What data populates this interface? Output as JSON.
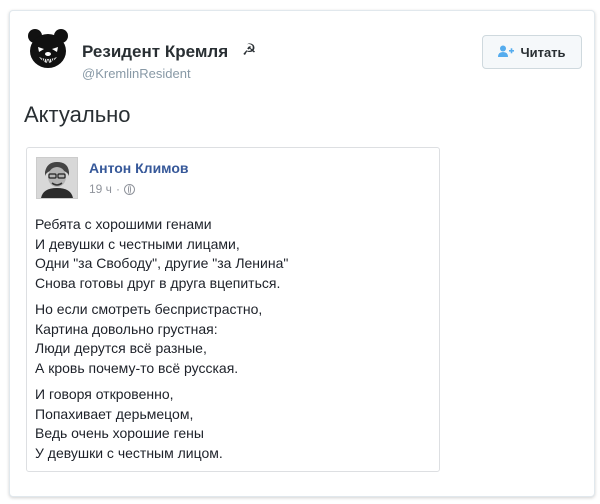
{
  "tweet": {
    "display_name": "Резидент Кремля",
    "name_emoji": "☭",
    "handle": "@KremlinResident",
    "follow_label": "Читать",
    "follow_icon": "add-user-icon",
    "text": "Актуально",
    "avatar_icon": "bear-icon"
  },
  "embed": {
    "author": "Антон Климов",
    "time": "19 ч",
    "separator": "·",
    "privacy_icon": "globe-icon",
    "photo": "portrait-photo",
    "stanzas": [
      [
        "Ребята с хорошими генами",
        "И девушки с честными лицами,",
        "Одни \"за Свободу\", другие \"за Ленина\"",
        "Снова готовы друг в друга вцепиться."
      ],
      [
        "Но если смотреть беспристрастно,",
        "Картина довольно грустная:",
        "Люди дерутся всё разные,",
        "А кровь почему-то всё русская."
      ],
      [
        "И говоря откровенно,",
        "Попахивает дерьмецом,",
        "Ведь очень хорошие гены",
        "У девушки с честным лицом."
      ]
    ]
  },
  "colors": {
    "name_link": "#365899",
    "meta_gray": "#90949c",
    "handle_gray": "#8899a6"
  }
}
